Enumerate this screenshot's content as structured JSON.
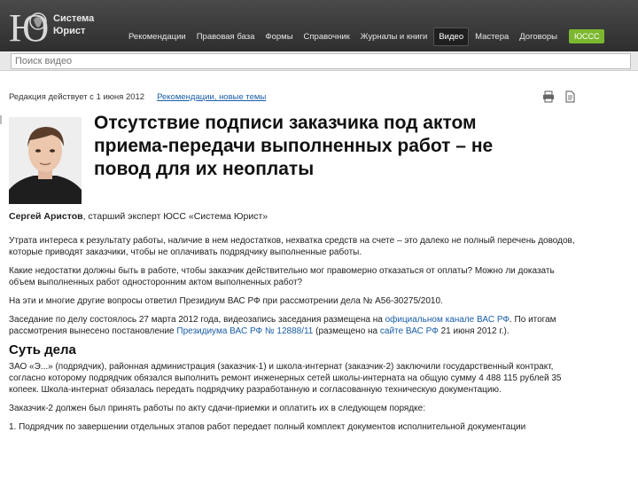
{
  "header": {
    "logo_line1": "Система",
    "logo_line2": "Юрист",
    "nav": [
      {
        "label": "Рекомендации",
        "active": false
      },
      {
        "label": "Правовая база",
        "active": false
      },
      {
        "label": "Формы",
        "active": false
      },
      {
        "label": "Справочник",
        "active": false
      },
      {
        "label": "Журналы и книги",
        "active": false
      },
      {
        "label": "Видео",
        "active": true
      },
      {
        "label": "Мастера",
        "active": false
      },
      {
        "label": "Договоры",
        "active": false
      }
    ],
    "badge": "ЮССС"
  },
  "search": {
    "placeholder": "Поиск видео"
  },
  "meta": {
    "edition": "Редакция действует с 1 июня 2012",
    "category_link": "Рекомендации, новые темы"
  },
  "article": {
    "title": "Отсутствие подписи заказчика под актом приема-передачи выполненных работ – не повод для их неоплаты",
    "author_name": "Сергей Аристов",
    "author_role": ", старший эксперт ЮСС «Система Юрист»",
    "p1": "Утрата интереса к результату работы, наличие в нем недостатков, нехватка средств на счете – это далеко не полный перечень доводов, которые приводят заказчики, чтобы не оплачивать подрядчику выполненные работы.",
    "p2": "Какие недостатки должны быть в работе, чтобы заказчик действительно мог правомерно отказаться от оплаты? Можно ли доказать объем выполненных работ односторонним актом выполненных работ?",
    "p3": "На эти и многие другие вопросы ответил Президиум ВАС РФ при рассмотрении дела № А56-30275/2010.",
    "p4_a": "Заседание по делу состоялось 27 марта 2012 года, видеозапись заседания размещена на ",
    "p4_link1": "официальном канале ВАС РФ",
    "p4_b": ". По итогам рассмотрения вынесено постановление ",
    "p4_link2": "Президиума ВАС РФ № 12888/11",
    "p4_c": " (размещено на ",
    "p4_link3": "сайте ВАС РФ",
    "p4_d": " 21 июня 2012 г.).",
    "section_title": "Суть дела",
    "p5": "ЗАО «Э...» (подрядчик), районная администрация (заказчик-1) и школа-интернат (заказчик-2) заключили государственный контракт, согласно которому подрядчик обязался выполнить ремонт инженерных сетей школы-интерната на общую сумму 4 488 115 рублей 35 копеек. Школа-интернат обязалась передать подрядчику разработанную и согласованную техническую документацию.",
    "p6": "Заказчик-2 должен был принять работы по акту сдачи-приемки и оплатить их в следующем порядке:",
    "p7": "1. Подрядчик по завершении отдельных этапов работ передает полный комплект документов исполнительной документации"
  }
}
